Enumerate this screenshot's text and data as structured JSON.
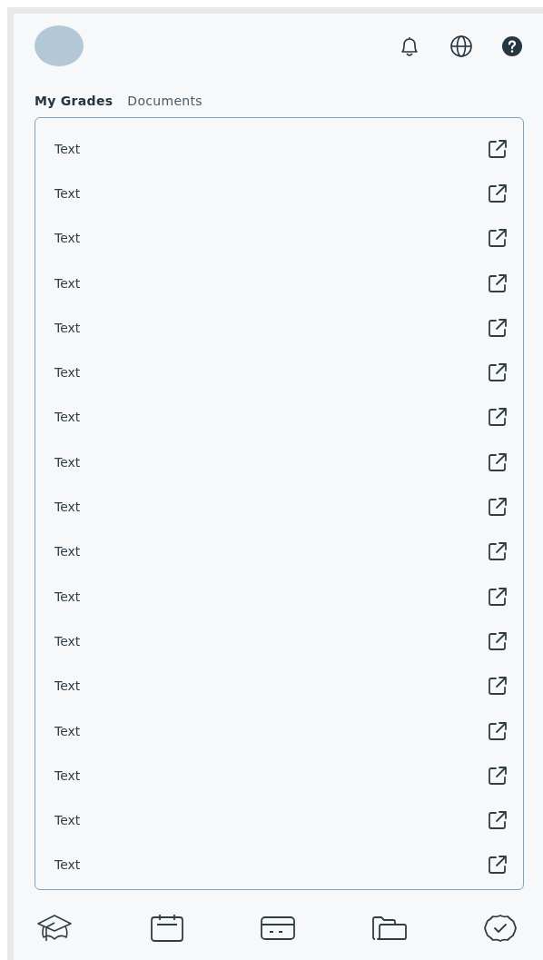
{
  "tabs": [
    {
      "label": "My Grades",
      "selected": true
    },
    {
      "label": "Documents",
      "selected": false
    }
  ],
  "rows": [
    {
      "label": "Text"
    },
    {
      "label": "Text"
    },
    {
      "label": "Text"
    },
    {
      "label": "Text"
    },
    {
      "label": "Text"
    },
    {
      "label": "Text"
    },
    {
      "label": "Text"
    },
    {
      "label": "Text"
    },
    {
      "label": "Text"
    },
    {
      "label": "Text"
    },
    {
      "label": "Text"
    },
    {
      "label": "Text"
    },
    {
      "label": "Text"
    },
    {
      "label": "Text"
    },
    {
      "label": "Text"
    },
    {
      "label": "Text"
    },
    {
      "label": "Text"
    }
  ],
  "nav": [
    {
      "kind": "grad"
    },
    {
      "kind": "calendar"
    },
    {
      "kind": "card"
    },
    {
      "kind": "folder"
    },
    {
      "kind": "badge"
    }
  ]
}
